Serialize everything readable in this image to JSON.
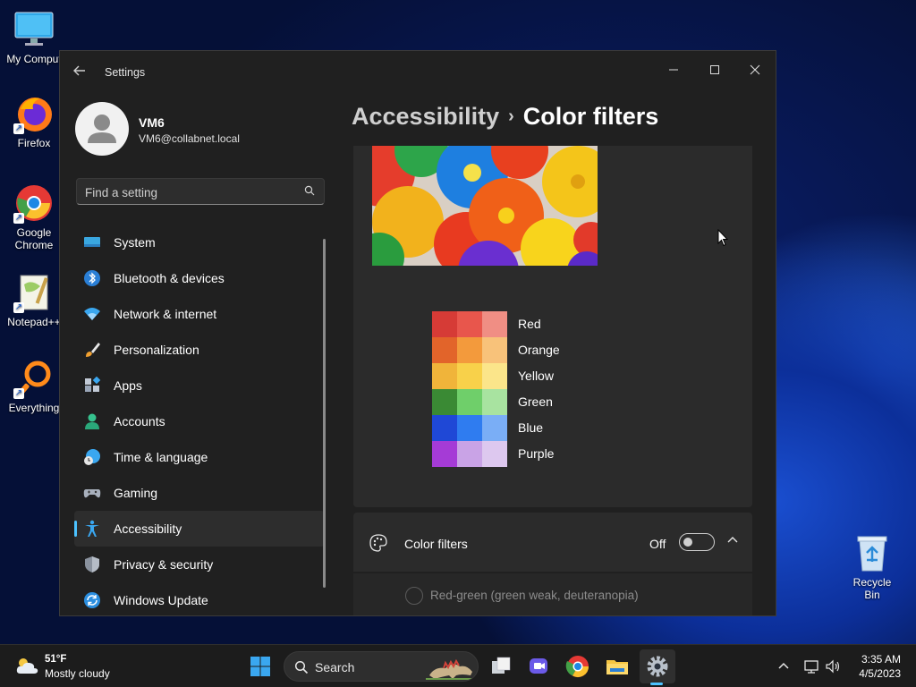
{
  "desktop": {
    "icons": [
      {
        "label": "My Comput"
      },
      {
        "label": "Firefox"
      },
      {
        "label": "Google Chrome"
      },
      {
        "label": "Notepad++"
      },
      {
        "label": "Everything"
      }
    ],
    "recycle_bin": "Recycle Bin"
  },
  "window": {
    "title": "Settings",
    "controls": {
      "minimize": "—",
      "maximize": "☐",
      "close": "✕"
    }
  },
  "profile": {
    "name": "VM6",
    "email": "VM6@collabnet.local"
  },
  "search": {
    "placeholder": "Find a setting"
  },
  "sidebar": {
    "items": [
      {
        "label": "System",
        "icon": "monitor-icon"
      },
      {
        "label": "Bluetooth & devices",
        "icon": "bluetooth-icon"
      },
      {
        "label": "Network & internet",
        "icon": "wifi-icon"
      },
      {
        "label": "Personalization",
        "icon": "brush-icon"
      },
      {
        "label": "Apps",
        "icon": "apps-icon"
      },
      {
        "label": "Accounts",
        "icon": "person-icon"
      },
      {
        "label": "Time & language",
        "icon": "clock-globe-icon"
      },
      {
        "label": "Gaming",
        "icon": "gamepad-icon"
      },
      {
        "label": "Accessibility",
        "icon": "accessibility-icon",
        "active": true
      },
      {
        "label": "Privacy & security",
        "icon": "shield-icon"
      },
      {
        "label": "Windows Update",
        "icon": "update-icon"
      }
    ]
  },
  "breadcrumb": {
    "parent": "Accessibility",
    "separator": "›",
    "current": "Color filters"
  },
  "swatches": [
    {
      "label": "Red",
      "colors": [
        "#d63b36",
        "#e8564c",
        "#f08e84"
      ]
    },
    {
      "label": "Orange",
      "colors": [
        "#e2642a",
        "#f39a3c",
        "#f8c27a"
      ]
    },
    {
      "label": "Yellow",
      "colors": [
        "#f0b43a",
        "#f8d14a",
        "#fbe58a"
      ]
    },
    {
      "label": "Green",
      "colors": [
        "#3a8a34",
        "#6fcf6a",
        "#a8e3a0"
      ]
    },
    {
      "label": "Blue",
      "colors": [
        "#1f48d6",
        "#2f7cf0",
        "#7aaef6"
      ]
    },
    {
      "label": "Purple",
      "colors": [
        "#a53bd6",
        "#c9a3e6",
        "#ddc8ef"
      ]
    }
  ],
  "color_filters": {
    "label": "Color filters",
    "state": "Off",
    "option": "Red-green (green weak, deuteranopia)"
  },
  "taskbar": {
    "weather_temp": "51°F",
    "weather_desc": "Mostly cloudy",
    "search_label": "Search",
    "time": "3:35 AM",
    "date": "4/5/2023"
  },
  "colors": {
    "accent": "#4cc2ff",
    "window_bg": "#202020",
    "card_bg": "#2b2b2b"
  }
}
